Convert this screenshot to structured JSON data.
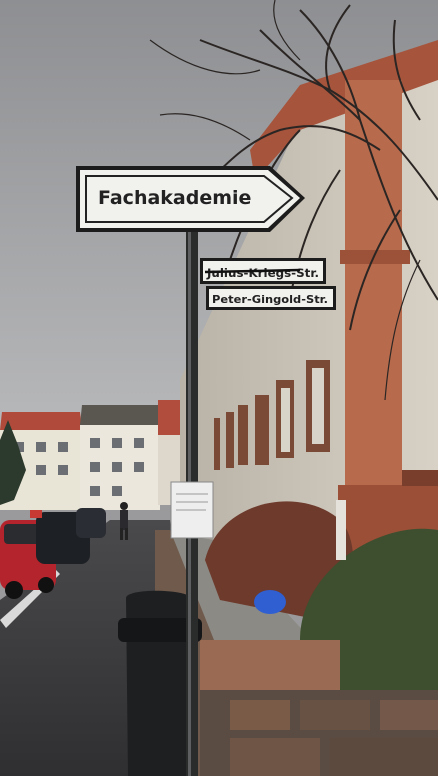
{
  "signs": {
    "main": "Fachakademie",
    "street_crossed_out": "Julius-Kriegs-Str.",
    "street_current": "Peter-Gingold-Str."
  }
}
